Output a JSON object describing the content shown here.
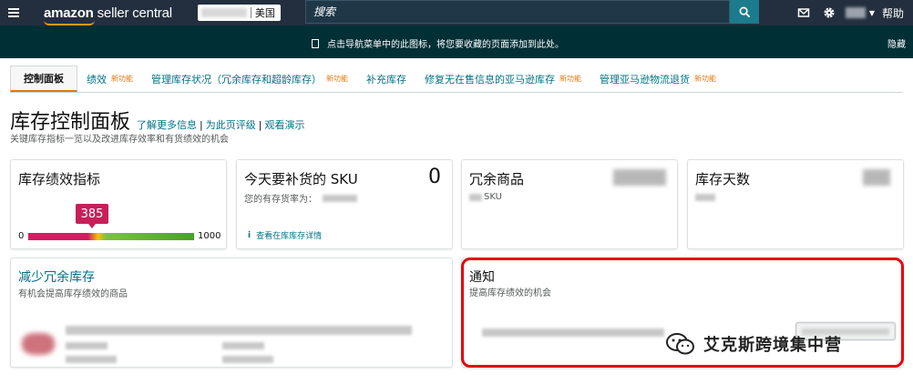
{
  "topbar": {
    "logo_main": "amazon",
    "logo_rest": "seller central",
    "store_country": "美国",
    "search_placeholder": "搜索",
    "help_label": "帮助"
  },
  "banner": {
    "message": "点击导航菜单中的此图标，将您要收藏的页面添加到此处。",
    "hide_label": "隐藏"
  },
  "tabs": [
    {
      "label": "控制面板",
      "new_badge": ""
    },
    {
      "label": "绩效",
      "new_badge": "新功能"
    },
    {
      "label": "管理库存状况（冗余库存和超龄库存）",
      "new_badge": "新功能"
    },
    {
      "label": "补充库存",
      "new_badge": ""
    },
    {
      "label": "修复无在售信息的亚马逊库存",
      "new_badge": "新功能"
    },
    {
      "label": "管理亚马逊物流退货",
      "new_badge": "新功能"
    }
  ],
  "page": {
    "title": "库存控制面板",
    "links": [
      "了解更多信息",
      "为此页评级",
      "观看演示"
    ],
    "subtitle": "关键库存指标一览以及改进库存效率和有货绩效的机会"
  },
  "cards": {
    "ipi": {
      "title": "库存绩效指标",
      "score": "385",
      "score_value": 385,
      "min": "0",
      "max": "1000"
    },
    "restock": {
      "title": "今天要补货的 SKU",
      "count": "0",
      "sub_label": "您的有存货率为：",
      "link": "查看在库库存详情"
    },
    "excess": {
      "title": "冗余商品",
      "sub_label": "SKU"
    },
    "days": {
      "title": "库存天数"
    },
    "reduce": {
      "title": "减少冗余库存",
      "subtitle": "有机会提高库存绩效的商品"
    },
    "notify": {
      "title": "通知",
      "subtitle": "提高库存绩效的机会"
    }
  },
  "watermark": {
    "text": "艾克斯跨境集中营"
  },
  "colors": {
    "topbar": "#232f3e",
    "banner": "#002f36",
    "link": "#007185",
    "new_badge": "#e47911",
    "ipi_bubble": "#c81f5a",
    "highlight": "#e8000b"
  }
}
